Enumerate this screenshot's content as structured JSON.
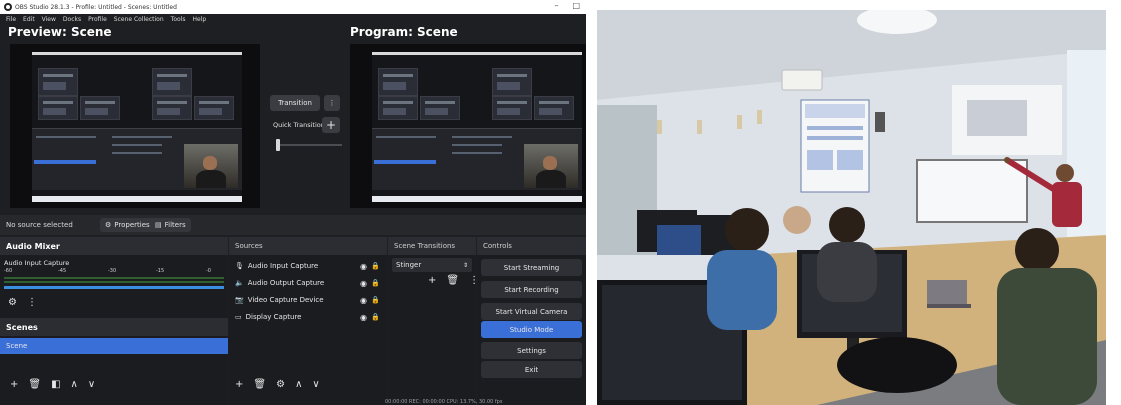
{
  "obs": {
    "window_title": "OBS Studio 28.1.3 - Profile: Untitled - Scenes: Untitled",
    "window_controls": [
      "–",
      "□"
    ],
    "menu": [
      "File",
      "Edit",
      "View",
      "Docks",
      "Profile",
      "Scene Collection",
      "Tools",
      "Help"
    ],
    "preview_title": "Preview: Scene",
    "program_title": "Program: Scene",
    "transition_button": "Transition",
    "quick_transitions_label": "Quick Transitions",
    "plus_symbol": "+",
    "more_symbol": "⋮",
    "no_source_selected": "No source selected",
    "properties_button": "Properties",
    "filters_button": "Filters",
    "audio_mixer": {
      "title": "Audio Mixer",
      "channel_name": "Audio Input Capture",
      "meter_ticks": [
        "-60",
        "-45",
        "-30",
        "-15",
        "-0"
      ]
    },
    "scenes": {
      "title": "Scenes",
      "items": [
        "Scene"
      ]
    },
    "sources": {
      "title": "Sources",
      "items": [
        {
          "label": "Audio Input Capture",
          "icon": "microphone-icon"
        },
        {
          "label": "Audio Output Capture",
          "icon": "speaker-icon"
        },
        {
          "label": "Video Capture Device",
          "icon": "camera-icon"
        },
        {
          "label": "Display Capture",
          "icon": "monitor-icon"
        }
      ]
    },
    "scene_transitions": {
      "title": "Scene Transitions",
      "selected": "Stinger"
    },
    "controls": {
      "title": "Controls",
      "buttons": [
        "Start Streaming",
        "Start Recording",
        "Start Virtual Camera",
        "Studio Mode",
        "Settings",
        "Exit"
      ],
      "active_button": "Studio Mode"
    },
    "footer_status": "00:00:00   REC: 00:00:00   CPU: 13.7%, 30.00 fps",
    "accent_color": "#3b6fd8"
  },
  "photo": {
    "description_icon": "classroom-photo"
  }
}
